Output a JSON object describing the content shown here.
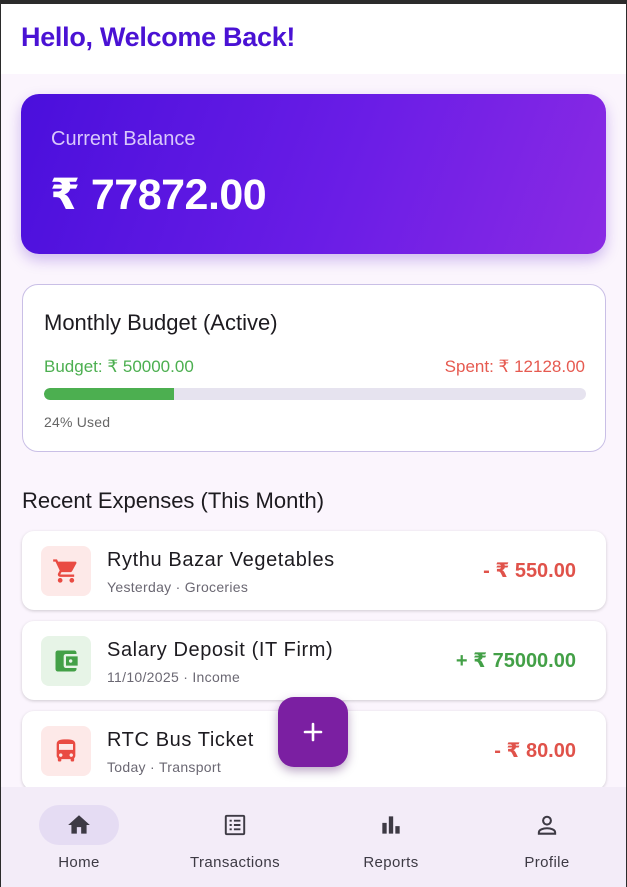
{
  "app_bar": {
    "title": "Hello, Welcome Back!"
  },
  "balance": {
    "label": "Current Balance",
    "value": "₹ 77872.00"
  },
  "budget": {
    "title": "Monthly Budget (Active)",
    "budget_label": "Budget: ₹ 50000.00",
    "spent_label": "Spent: ₹ 12128.00",
    "used_fraction": 0.24,
    "used_label": "24% Used"
  },
  "recent": {
    "title": "Recent Expenses (This Month)",
    "items": [
      {
        "title": "Rythu Bazar Vegetables",
        "meta": "Yesterday · Groceries",
        "amount": "- ₹ 550.00",
        "kind": "expense",
        "icon": "cart-icon"
      },
      {
        "title": "Salary Deposit (IT Firm)",
        "meta": "11/10/2025 · Income",
        "amount": "+ ₹ 75000.00",
        "kind": "income",
        "icon": "wallet-icon"
      },
      {
        "title": "RTC Bus Ticket",
        "meta": "Today · Transport",
        "amount": "- ₹ 80.00",
        "kind": "expense",
        "icon": "bus-icon"
      }
    ]
  },
  "fab": {
    "icon": "plus-icon"
  },
  "nav": {
    "items": [
      {
        "label": "Home",
        "icon": "home-icon",
        "active": true
      },
      {
        "label": "Transactions",
        "icon": "receipt-icon",
        "active": false
      },
      {
        "label": "Reports",
        "icon": "bar-chart-icon",
        "active": false
      },
      {
        "label": "Profile",
        "icon": "person-icon",
        "active": false
      }
    ]
  },
  "colors": {
    "primary": "#4a12d4",
    "income": "#43a047",
    "expense": "#e0524a",
    "fab": "#7b1fa2"
  }
}
